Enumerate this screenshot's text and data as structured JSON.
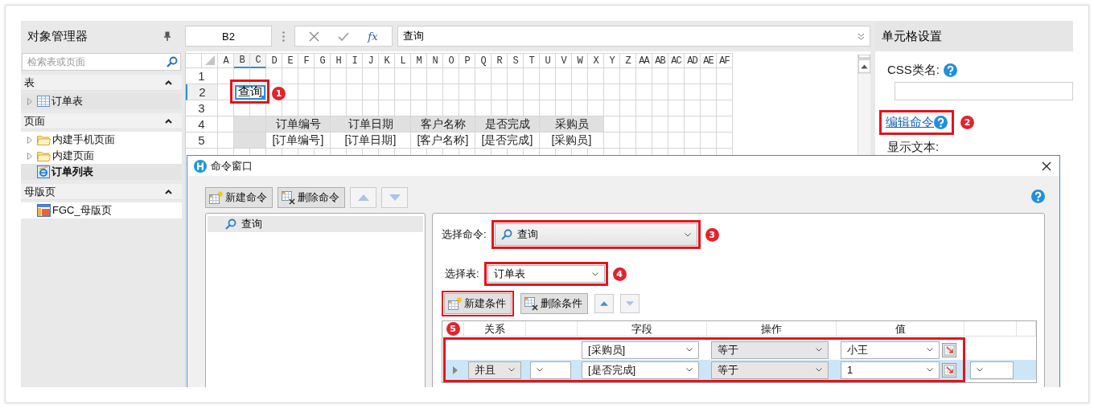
{
  "object_manager": {
    "title": "对象管理器",
    "search": {
      "placeholder": "检索表或页面"
    },
    "sections": [
      {
        "title": "表",
        "expanded": true,
        "items": [
          {
            "label": "订单表",
            "kind": "table",
            "expandable": true,
            "highlighted": true,
            "selected": false
          }
        ]
      },
      {
        "title": "页面",
        "expanded": true,
        "items": [
          {
            "label": "内建手机页面",
            "kind": "folder",
            "expandable": true,
            "highlighted": false,
            "selected": false
          },
          {
            "label": "内建页面",
            "kind": "folder",
            "expandable": true,
            "highlighted": false,
            "selected": false
          },
          {
            "label": "订单列表",
            "kind": "page",
            "expandable": false,
            "highlighted": true,
            "selected": true
          }
        ]
      },
      {
        "title": "母版页",
        "expanded": true,
        "items": [
          {
            "label": "FGC_母版页",
            "kind": "master",
            "expandable": false,
            "highlighted": false,
            "selected": false
          }
        ]
      }
    ]
  },
  "formula_bar": {
    "cell_ref": "B2",
    "function_label": "fx",
    "formula": "查询"
  },
  "sheet": {
    "columns": [
      {
        "label": "A",
        "selected": false
      },
      {
        "label": "B",
        "selected": true
      },
      {
        "label": "C",
        "selected": true
      },
      {
        "label": "D",
        "selected": false
      },
      {
        "label": "E",
        "selected": false
      },
      {
        "label": "F",
        "selected": false
      },
      {
        "label": "G",
        "selected": false
      },
      {
        "label": "H",
        "selected": false
      },
      {
        "label": "I",
        "selected": false
      },
      {
        "label": "J",
        "selected": false
      },
      {
        "label": "K",
        "selected": false
      },
      {
        "label": "L",
        "selected": false
      },
      {
        "label": "M",
        "selected": false
      },
      {
        "label": "N",
        "selected": false
      },
      {
        "label": "O",
        "selected": false
      },
      {
        "label": "P",
        "selected": false
      },
      {
        "label": "Q",
        "selected": false
      },
      {
        "label": "R",
        "selected": false
      },
      {
        "label": "S",
        "selected": false
      },
      {
        "label": "T",
        "selected": false
      },
      {
        "label": "U",
        "selected": false
      },
      {
        "label": "V",
        "selected": false
      },
      {
        "label": "W",
        "selected": false
      },
      {
        "label": "X",
        "selected": false
      },
      {
        "label": "Y",
        "selected": false
      },
      {
        "label": "Z",
        "selected": false
      },
      {
        "label": "AA",
        "selected": false
      },
      {
        "label": "AB",
        "selected": false
      },
      {
        "label": "AC",
        "selected": false
      },
      {
        "label": "AD",
        "selected": false
      },
      {
        "label": "AE",
        "selected": false
      },
      {
        "label": "AF",
        "selected": false
      }
    ],
    "rows": [
      {
        "label": "1",
        "selected": false
      },
      {
        "label": "2",
        "selected": true
      },
      {
        "label": "3",
        "selected": false
      },
      {
        "label": "4",
        "selected": false
      },
      {
        "label": "5",
        "selected": false
      }
    ],
    "query_button": {
      "text": "查询",
      "selected": true,
      "callout": "1"
    },
    "list_headers": [
      "订单编号",
      "订单日期",
      "客户名称",
      "是否完成",
      "采购员"
    ],
    "list_fields": [
      "[订单编号]",
      "[订单日期]",
      "[客户名称]",
      "[是否完成]",
      "[采购员]"
    ]
  },
  "cell_settings": {
    "title": "单元格设置",
    "css_class_label": "CSS类名:",
    "edit_command": {
      "text": "编辑命令",
      "callout": "2"
    },
    "display_text_label": "显示文本:"
  },
  "command_dialog": {
    "title": "命令窗口",
    "toolbar": [
      {
        "kind": "new",
        "label": "新建命令"
      },
      {
        "kind": "delete",
        "label": "删除命令"
      },
      {
        "kind": "up",
        "disabled": true
      },
      {
        "kind": "down",
        "disabled": true
      }
    ],
    "commands": [
      {
        "label": "查询",
        "selected": true
      }
    ],
    "command_select": {
      "label": "选择命令:",
      "value": "查询",
      "callout": "3"
    },
    "table_select": {
      "label": "选择表:",
      "value": "订单表",
      "callout": "4"
    },
    "condition_toolbar": [
      {
        "kind": "new",
        "label": "新建条件",
        "outlined": true
      },
      {
        "kind": "delete",
        "label": "删除条件",
        "outlined": false
      },
      {
        "kind": "up",
        "disabled": false
      },
      {
        "kind": "down",
        "disabled": true
      }
    ],
    "conditions": {
      "callout": "5",
      "columns": [
        "关系",
        "字段",
        "操作",
        "值"
      ],
      "rows": [
        {
          "kind": "first",
          "field": "[采购员]",
          "operator": "等于",
          "value": "小王",
          "selected": false
        },
        {
          "kind": "joined",
          "relation": "并且",
          "field": "[是否完成]",
          "operator": "等于",
          "value": "1",
          "selected": true
        }
      ]
    }
  }
}
